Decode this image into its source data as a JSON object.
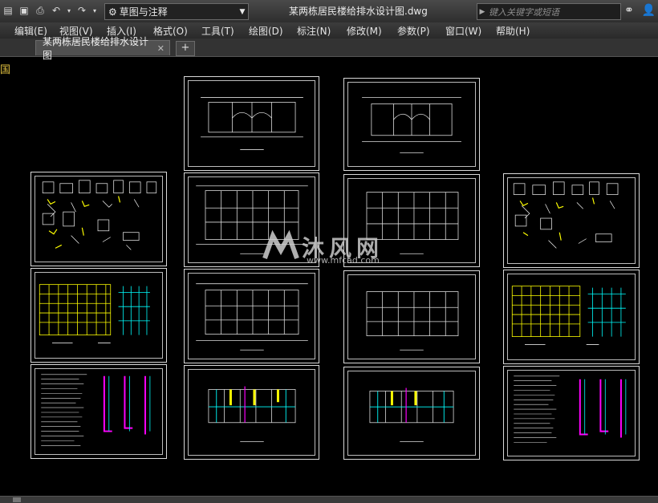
{
  "title_bar": {
    "workspace_label": "草图与注释",
    "window_title": "某两栋居民楼给排水设计图.dwg",
    "search_placeholder": "键入关键字或短语"
  },
  "menu": {
    "items": [
      "编辑(E)",
      "视图(V)",
      "插入(I)",
      "格式(O)",
      "工具(T)",
      "绘图(D)",
      "标注(N)",
      "修改(M)",
      "参数(P)",
      "窗口(W)",
      "帮助(H)"
    ]
  },
  "tabs": {
    "active_document": "某两栋居民楼给排水设计图",
    "close_glyph": "✕",
    "add_glyph": "+"
  },
  "viewport": {
    "partial_label": "国"
  },
  "watermark": {
    "text": "沐风网",
    "url": "www.mfcad.com"
  },
  "icons": [
    "new-file-icon",
    "save-icon",
    "print-icon",
    "undo-icon",
    "redo-icon",
    "gear-icon",
    "search-icon",
    "binoculars-icon",
    "user-icon"
  ],
  "colors": {
    "background": "#000000",
    "sheet_border": "#d9d9d9",
    "drawing_yellow": "#ffff00",
    "drawing_cyan": "#00ffff",
    "drawing_magenta": "#ff00ff"
  }
}
